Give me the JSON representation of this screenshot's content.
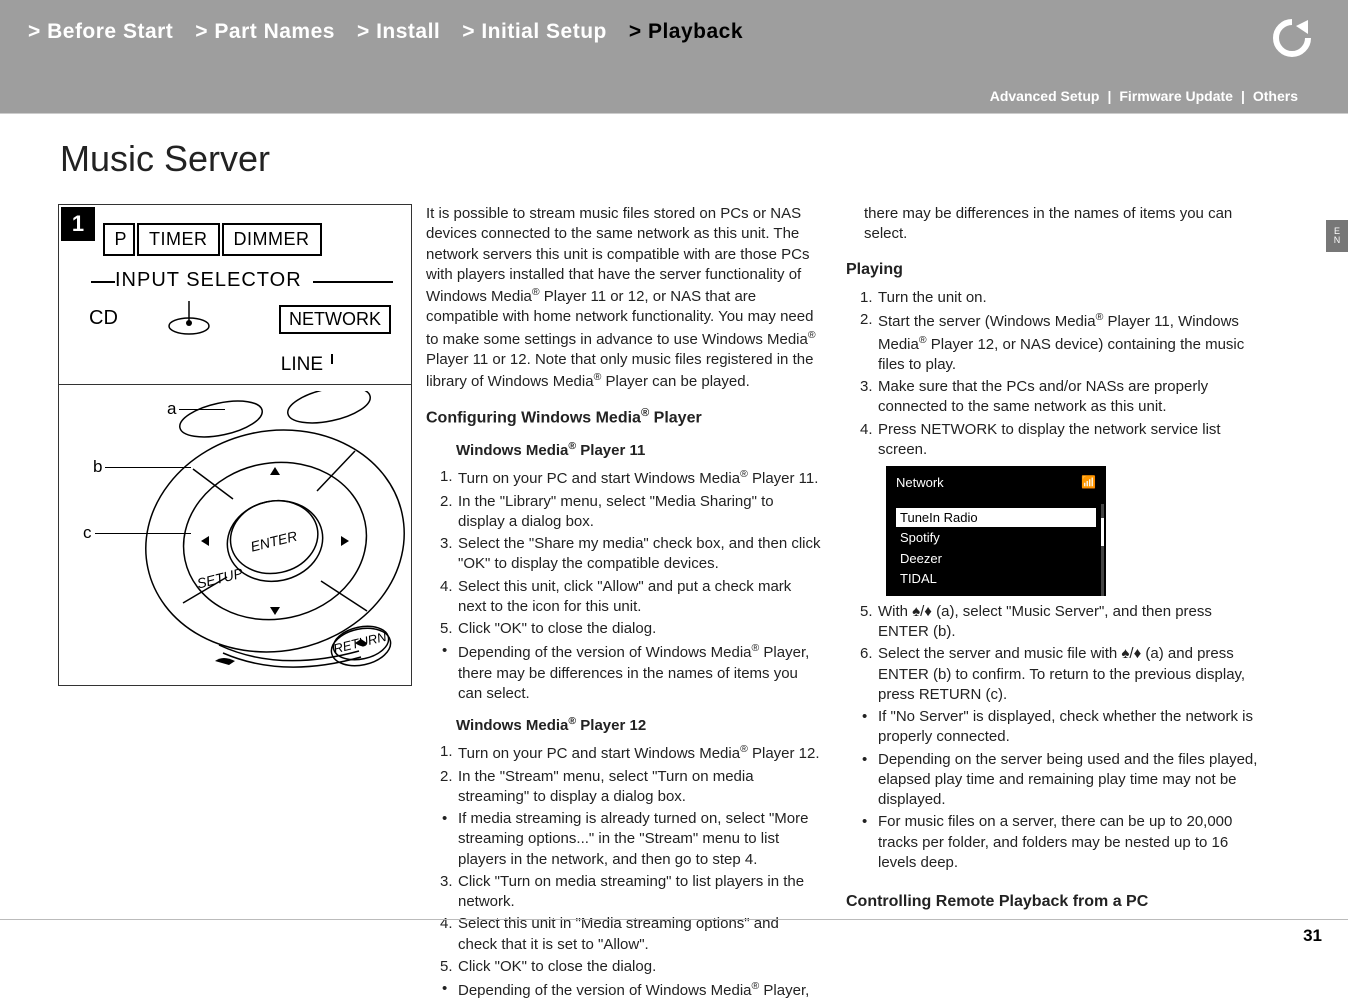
{
  "breadcrumbs": {
    "items": [
      "> Before Start",
      "> Part Names",
      "> Install",
      "> Initial Setup",
      "> Playback"
    ],
    "activeIndex": 4
  },
  "sublinks": {
    "a": "Advanced Setup",
    "b": "Firmware Update",
    "c": "Others"
  },
  "lang": {
    "l1": "E",
    "l2": "N"
  },
  "title": "Music Server",
  "diagram": {
    "badge": "1",
    "btn_half": "P",
    "btn_timer": "TIMER",
    "btn_dimmer": "DIMMER",
    "input_selector": "INPUT SELECTOR",
    "cd": "CD",
    "network": "NETWORK",
    "line": "LINE",
    "a": "a",
    "b": "b",
    "c": "c",
    "enter": "ENTER",
    "setup": "SETUP",
    "return": "RETURN"
  },
  "intro": "It is possible to stream music files stored on PCs or NAS devices connected to the same network as this unit. The network servers this unit is compatible with are those PCs with players installed that have the server functionality of Windows Media® Player 11 or 12, or NAS that are compatible with home network functionality. You may need to make some settings in advance to use Windows Media® Player 11 or 12. Note that only music files registered in the library of Windows Media® Player can be played.",
  "h_config": "Configuring Windows Media® Player",
  "h_wmp11": "Windows Media® Player 11",
  "wmp11": [
    "Turn on your PC and start Windows Media® Player 11.",
    "In the \"Library\" menu, select \"Media Sharing\" to display a dialog box.",
    "Select the \"Share my media\" check box, and then click \"OK\" to display the compatible devices.",
    "Select this unit, click \"Allow\" and put a check mark next to the icon for this unit.",
    "Click \"OK\" to close the dialog."
  ],
  "wmp11_note": "Depending of the version of Windows Media® Player, there may be differences in the names of items you can select.",
  "h_wmp12": "Windows Media® Player 12",
  "wmp12": [
    "Turn on your PC and start Windows Media® Player 12.",
    "In the \"Stream\" menu, select \"Turn on media streaming\" to display a dialog box."
  ],
  "wmp12_note1": "If media streaming is already turned on, select \"More streaming options...\" in the \"Stream\" menu to list players in the network, and then go to step 4.",
  "wmp12b": [
    "Click \"Turn on media streaming\" to list players in the network.",
    "Select this unit in \"Media streaming options\" and check that it is set to \"Allow\".",
    "Click \"OK\" to close the dialog."
  ],
  "wmp12_note2": "Depending of the version of Windows Media® Player,",
  "col3_top": "there may be differences in the names of items you can select.",
  "h_playing": "Playing",
  "playing": [
    "Turn the unit on.",
    "Start the server (Windows Media® Player 11, Windows Media® Player 12, or NAS device) containing the music files to play.",
    "Make sure that the PCs and/or NASs are properly connected to the same network as this unit.",
    "Press NETWORK to display the network service list screen."
  ],
  "screen": {
    "title": "Network",
    "items": [
      "TuneIn Radio",
      "Spotify",
      "Deezer",
      "TIDAL"
    ],
    "selected": 0
  },
  "playing2": [
    "With ♠/♦ (a), select \"Music Server\", and then press ENTER (b).",
    "Select the server and music file with ♠/♦ (a) and press ENTER (b) to confirm. To return to the previous display, press RETURN (c)."
  ],
  "playing_notes": [
    "If \"No Server\" is displayed, check whether the network is properly connected.",
    "Depending on the server being used and the files played, elapsed play time and remaining play time may not be displayed.",
    "For music files on a server, there can be up to 20,000 tracks per folder, and folders may be nested up to 16 levels deep."
  ],
  "h_remote": "Controlling Remote Playback from a PC",
  "pagenum": "31"
}
